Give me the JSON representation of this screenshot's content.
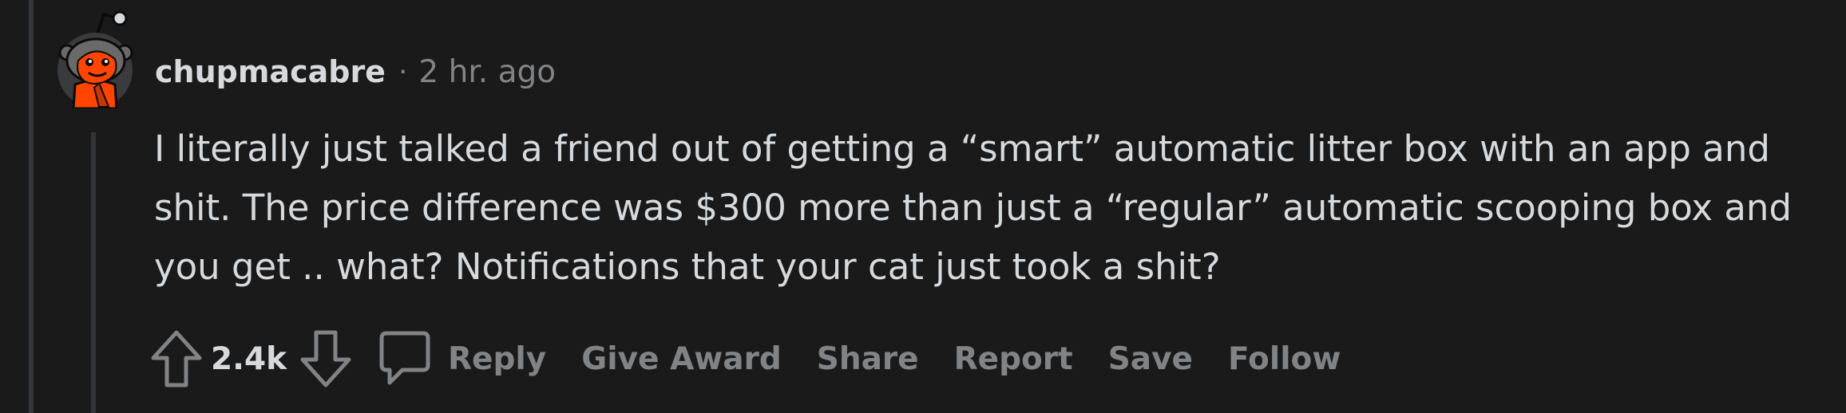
{
  "comment": {
    "username": "chupmacabre",
    "separator": "·",
    "timestamp": "2 hr. ago",
    "body": "I literally just talked a friend out of getting a “smart” automatic litter box with an app and shit. The price difference was $300 more than just a “regular” automatic scooping box and you get .. what? Notifications that your cat just took a shit?",
    "score": "2.4k"
  },
  "actions": {
    "reply": "Reply",
    "give_award": "Give Award",
    "share": "Share",
    "report": "Report",
    "save": "Save",
    "follow": "Follow"
  },
  "icons": {
    "avatar": "snoo-avatar",
    "upvote": "arrow-up-icon",
    "downvote": "arrow-down-icon",
    "reply": "speech-bubble-icon"
  },
  "colors": {
    "background": "#1a1a1b",
    "text_primary": "#d7dadc",
    "text_secondary": "#818384",
    "thread_line": "#343536",
    "avatar_accent": "#ff4500"
  }
}
